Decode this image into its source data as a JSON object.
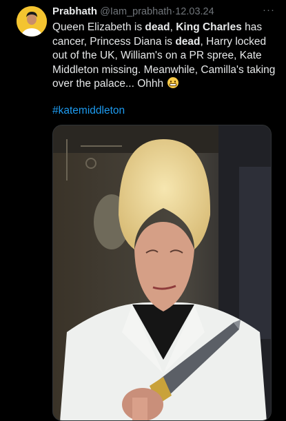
{
  "tweet": {
    "author_name": "Prabhath",
    "handle": "@Iam_prabhath",
    "separator": "·",
    "date": "12.03.24",
    "more_label": "···",
    "text_segments": [
      {
        "text": "Queen Elizabeth is ",
        "bold": false
      },
      {
        "text": "dead",
        "bold": true
      },
      {
        "text": ", ",
        "bold": false
      },
      {
        "text": "King Charles",
        "bold": true
      },
      {
        "text": " has cancer, Princess Diana is ",
        "bold": false
      },
      {
        "text": "dead",
        "bold": true
      },
      {
        "text": ", Harry locked out of the UK, William's on a PR spree, Kate Middleton missing.  Meanwhile, Camilla's taking over the palace... Ohhh",
        "bold": false
      }
    ],
    "emoji": "grimacing-face",
    "hashtag": "#katemiddleton"
  },
  "icons": {
    "avatar": "user-avatar",
    "more": "more-options-icon"
  },
  "colors": {
    "background": "#000000",
    "text": "#e7e9ea",
    "muted": "#71767b",
    "link": "#1d9bf0"
  }
}
